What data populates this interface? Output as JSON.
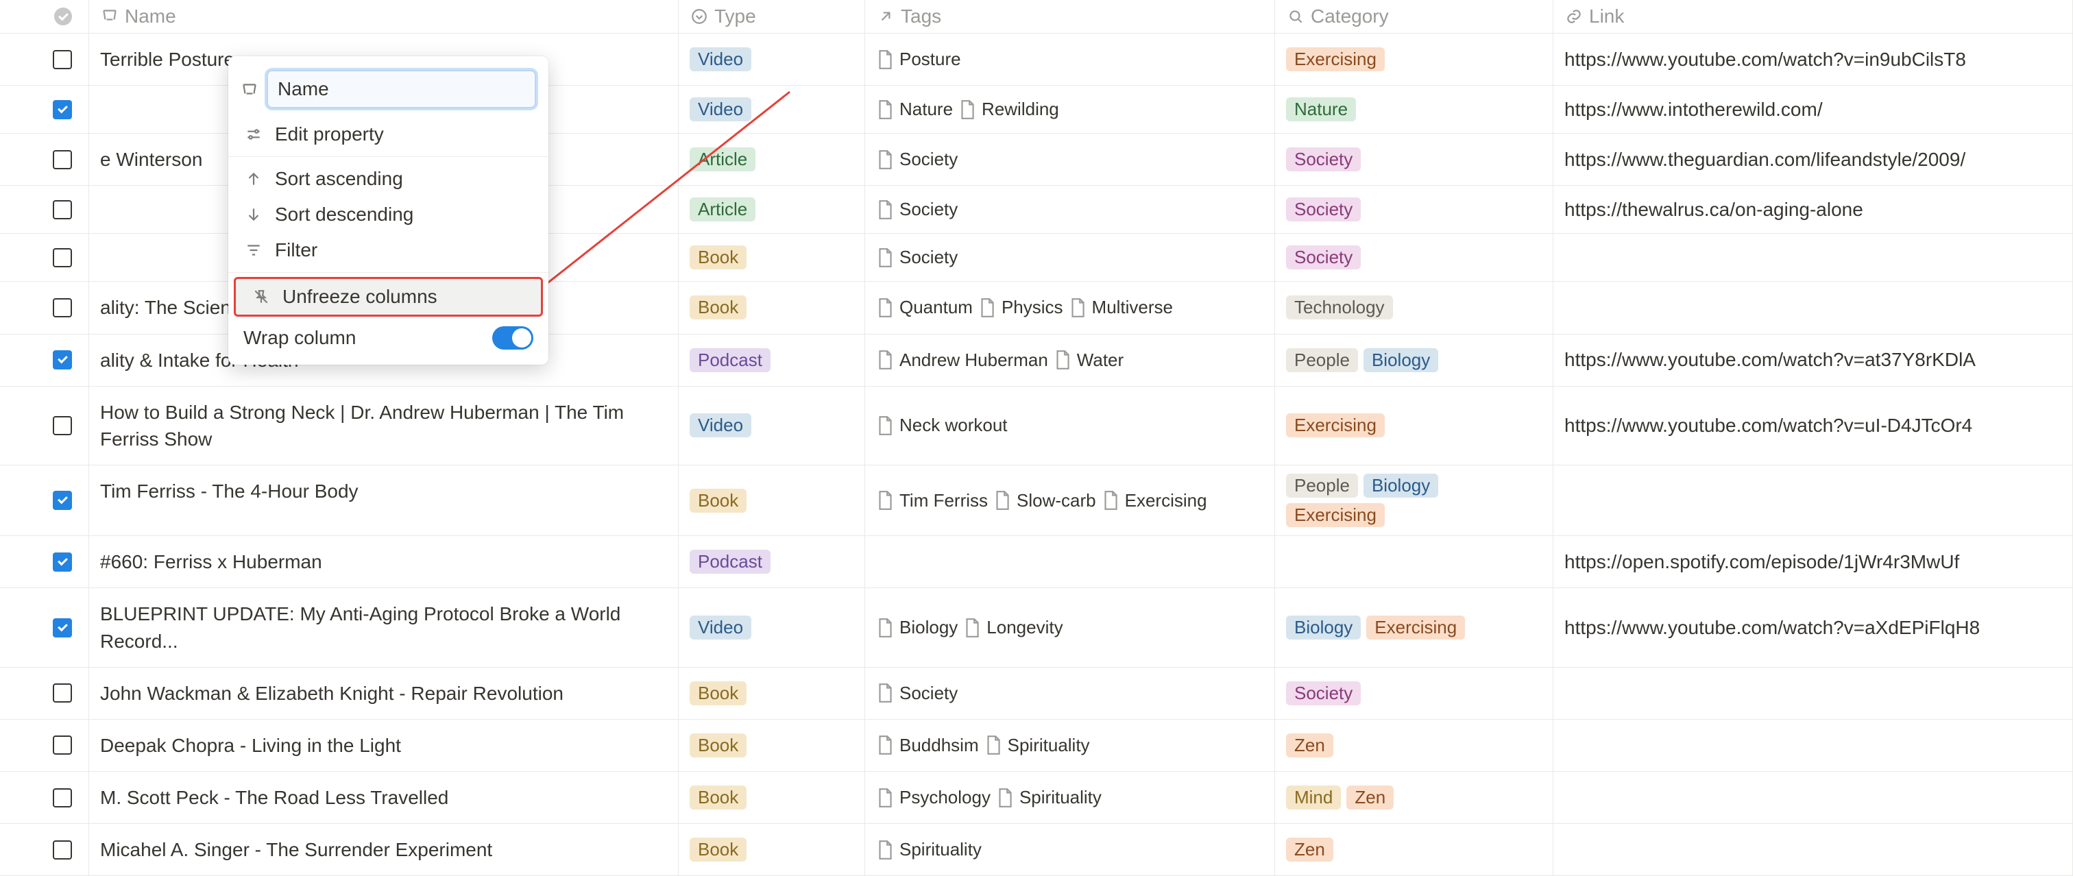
{
  "columns": {
    "name": "Name",
    "type": "Type",
    "tags": "Tags",
    "category": "Category",
    "link": "Link"
  },
  "popup": {
    "input_value": "Name",
    "edit_property": "Edit property",
    "sort_asc": "Sort ascending",
    "sort_desc": "Sort descending",
    "filter": "Filter",
    "unfreeze": "Unfreeze columns",
    "wrap": "Wrap column",
    "wrap_on": true
  },
  "type_labels": {
    "video": "Video",
    "article": "Article",
    "book": "Book",
    "podcast": "Podcast"
  },
  "rows": [
    {
      "checked": false,
      "name": "Terrible Posture",
      "type": "video",
      "tags": [
        "Posture"
      ],
      "cats": [
        {
          "t": "Exercising",
          "c": "exercising"
        }
      ],
      "link": "https://www.youtube.com/watch?v=in9ubCilsT8"
    },
    {
      "checked": true,
      "name": "",
      "type": "video",
      "tags": [
        "Nature",
        "Rewilding"
      ],
      "cats": [
        {
          "t": "Nature",
          "c": "nature"
        }
      ],
      "link": "https://www.intotherewild.com/"
    },
    {
      "checked": false,
      "name": "e Winterson",
      "type": "article",
      "tags": [
        "Society"
      ],
      "cats": [
        {
          "t": "Society",
          "c": "society"
        }
      ],
      "link": "https://www.theguardian.com/lifeandstyle/2009/"
    },
    {
      "checked": false,
      "name": "",
      "type": "article",
      "tags": [
        "Society"
      ],
      "cats": [
        {
          "t": "Society",
          "c": "society"
        }
      ],
      "link": "https://thewalrus.ca/on-aging-alone"
    },
    {
      "checked": false,
      "name": "",
      "type": "book",
      "tags": [
        "Society"
      ],
      "cats": [
        {
          "t": "Society",
          "c": "society"
        }
      ],
      "link": ""
    },
    {
      "checked": false,
      "name": "ality: The Science of",
      "type": "book",
      "tags": [
        "Quantum",
        "Physics",
        "Multiverse"
      ],
      "cats": [
        {
          "t": "Technology",
          "c": "technology"
        }
      ],
      "link": ""
    },
    {
      "checked": true,
      "name": "ality & Intake for Health",
      "type": "podcast",
      "tags": [
        "Andrew Huberman",
        "Water"
      ],
      "cats": [
        {
          "t": "People",
          "c": "people"
        },
        {
          "t": "Biology",
          "c": "biology"
        }
      ],
      "link": "https://www.youtube.com/watch?v=at37Y8rKDlA"
    },
    {
      "checked": false,
      "name": "How to Build a Strong Neck | Dr. Andrew Huberman | The Tim Ferriss Show",
      "type": "video",
      "tags": [
        "Neck workout"
      ],
      "cats": [
        {
          "t": "Exercising",
          "c": "exercising"
        }
      ],
      "link": "https://www.youtube.com/watch?v=uI-D4JTcOr4"
    },
    {
      "checked": true,
      "name": "Tim Ferriss - The 4-Hour Body",
      "type": "book",
      "tags": [
        "Tim Ferriss",
        "Slow-carb",
        "Exercising"
      ],
      "cats": [
        {
          "t": "People",
          "c": "people"
        },
        {
          "t": "Biology",
          "c": "biology"
        },
        {
          "t": "Exercising",
          "c": "exercising"
        }
      ],
      "link": ""
    },
    {
      "checked": true,
      "name": "#660: Ferriss x Huberman",
      "type": "podcast",
      "tags": [],
      "cats": [],
      "link": "https://open.spotify.com/episode/1jWr4r3MwUf"
    },
    {
      "checked": true,
      "name": "BLUEPRINT UPDATE: My Anti-Aging Protocol Broke a World Record...",
      "type": "video",
      "tags": [
        "Biology",
        "Longevity"
      ],
      "cats": [
        {
          "t": "Biology",
          "c": "biology"
        },
        {
          "t": "Exercising",
          "c": "exercising"
        }
      ],
      "link": "https://www.youtube.com/watch?v=aXdEPiFlqH8"
    },
    {
      "checked": false,
      "name": "John Wackman & Elizabeth Knight - Repair Revolution",
      "type": "book",
      "tags": [
        "Society"
      ],
      "cats": [
        {
          "t": "Society",
          "c": "society"
        }
      ],
      "link": ""
    },
    {
      "checked": false,
      "name": "Deepak Chopra - Living in the Light",
      "type": "book",
      "tags": [
        "Buddhsim",
        "Spirituality"
      ],
      "cats": [
        {
          "t": "Zen",
          "c": "zen"
        }
      ],
      "link": ""
    },
    {
      "checked": false,
      "name": "M. Scott Peck - The Road Less Travelled",
      "type": "book",
      "tags": [
        "Psychology",
        "Spirituality"
      ],
      "cats": [
        {
          "t": "Mind",
          "c": "mind"
        },
        {
          "t": "Zen",
          "c": "zen"
        }
      ],
      "link": ""
    },
    {
      "checked": false,
      "name": "Micahel A. Singer - The Surrender Experiment",
      "type": "book",
      "tags": [
        "Spirituality"
      ],
      "cats": [
        {
          "t": "Zen",
          "c": "zen"
        }
      ],
      "link": ""
    }
  ]
}
